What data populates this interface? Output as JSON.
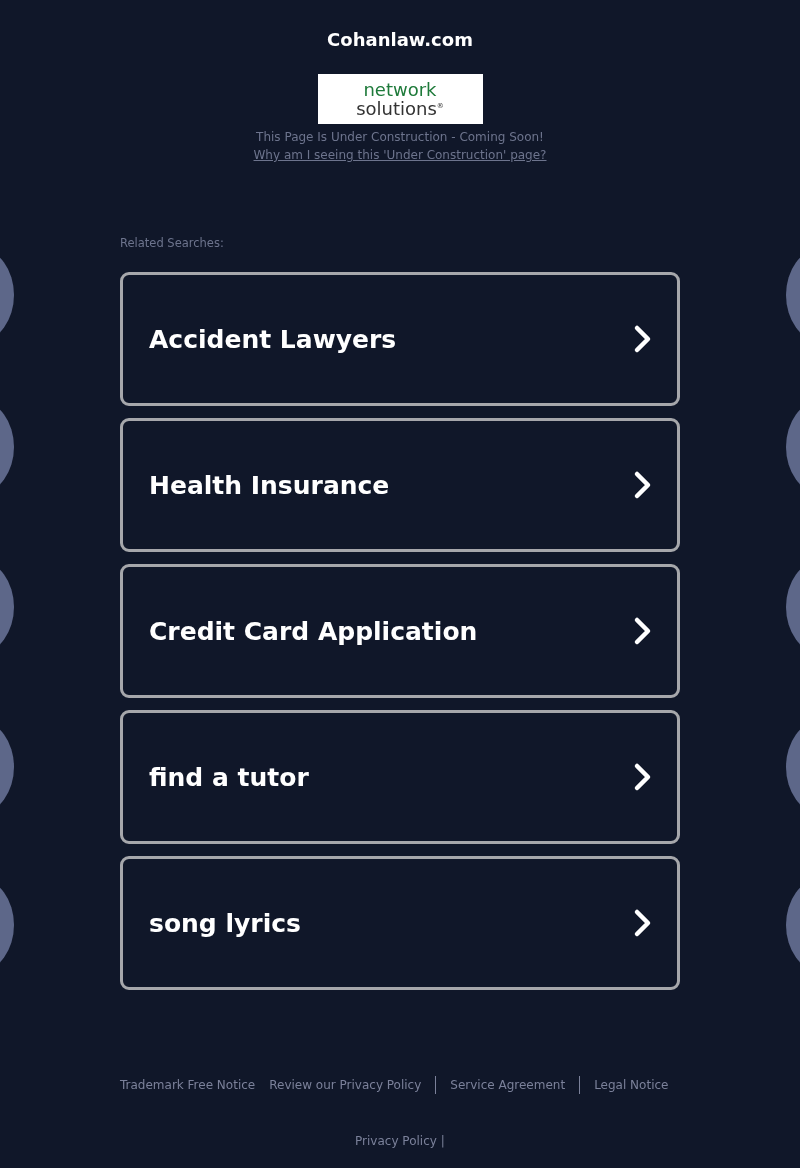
{
  "site_title": "Cohanlaw.com",
  "logo": {
    "line_1": "network",
    "line_2": "solutions",
    "mark": "®"
  },
  "notice": "This Page Is Under Construction - Coming Soon!",
  "notice_link": "Why am I seeing this 'Under Construction' page?",
  "related_heading": "Related Searches:",
  "searches": [
    {
      "label": "Accident Lawyers"
    },
    {
      "label": "Health Insurance"
    },
    {
      "label": "Credit Card Application"
    },
    {
      "label": "find a tutor"
    },
    {
      "label": "song lyrics"
    }
  ],
  "footer_links": [
    {
      "label": "Trademark Free Notice",
      "divider_after": false
    },
    {
      "label": "Review our Privacy Policy",
      "divider_after": true
    },
    {
      "label": "Service Agreement",
      "divider_after": true
    },
    {
      "label": "Legal Notice",
      "divider_after": false
    }
  ],
  "bottom_link": "Privacy Policy",
  "bottom_separator": "|"
}
